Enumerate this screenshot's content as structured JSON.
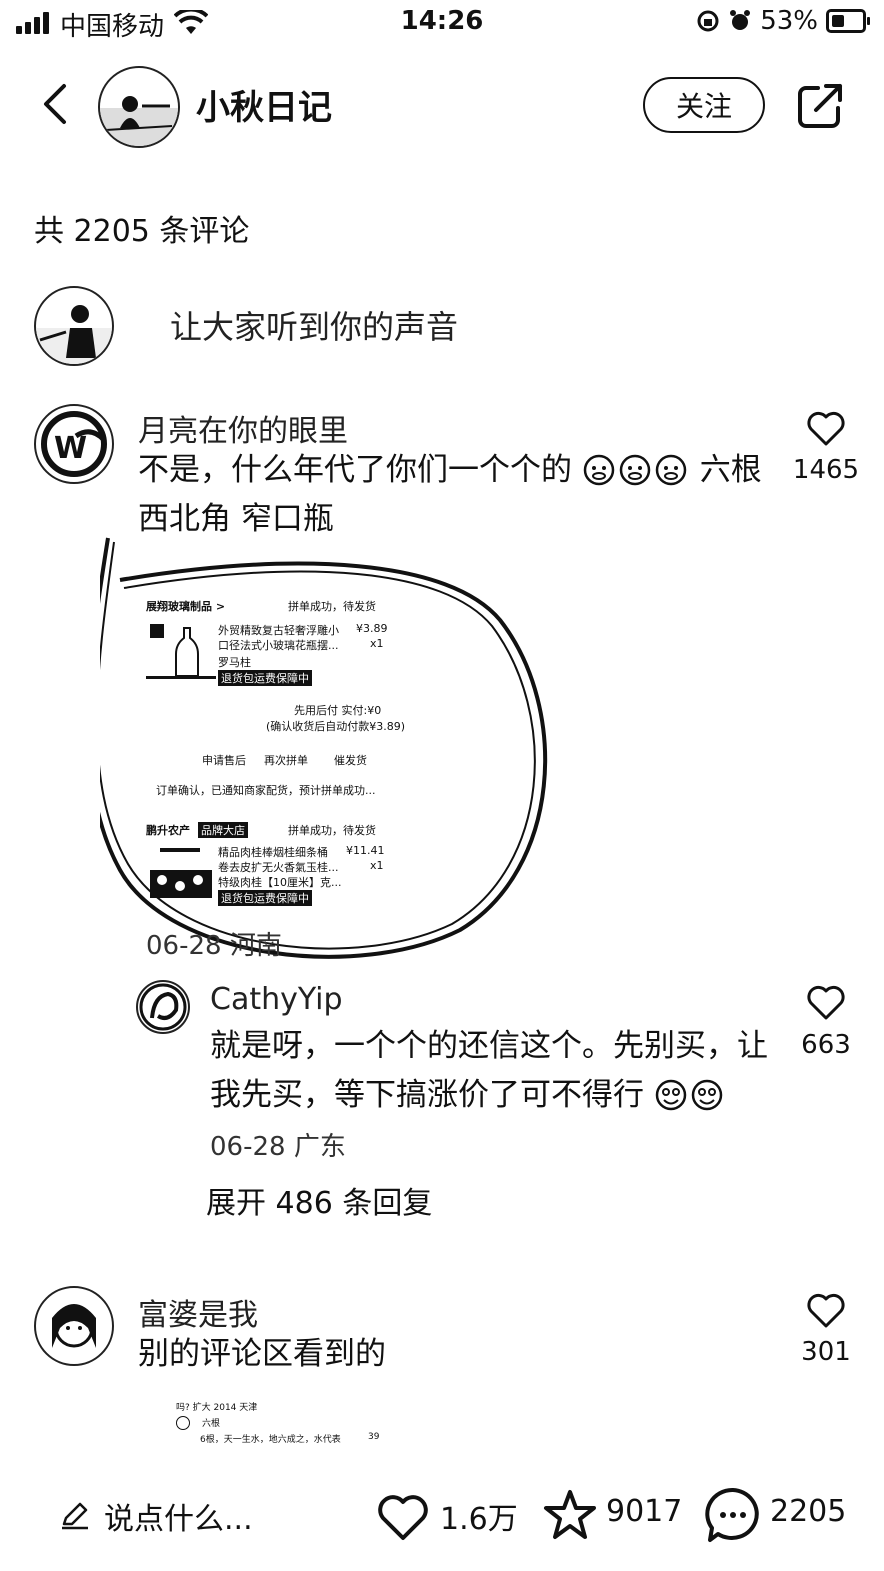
{
  "status_bar": {
    "carrier": "中国移动",
    "time": "14:26",
    "battery": "53%"
  },
  "header": {
    "title": "小秋日记",
    "follow_label": "关注"
  },
  "comments_count": "共 2205 条评论",
  "input_prompt": "让大家听到你的声音",
  "comments": [
    {
      "user": "月亮在你的眼里",
      "text_line1": "不是，什么年代了你们一个个的",
      "text_line1_tail": "六根",
      "text_line2": "西北角 窄口瓶",
      "meta": "06-28 河南",
      "likes": "1465",
      "image": {
        "shop1": "展翔玻璃制品 >",
        "status1": "拼单成功，待发货",
        "product1_line1": "外贸精致复古轻奢浮雕小",
        "product1_line2": "口径法式小玻璃花瓶摆...",
        "price1": "¥3.89",
        "qty1": "x1",
        "spec1": "罗马柱",
        "guarantee1": "退货包运费保障中",
        "pay_line1": "先用后付 实付:¥0",
        "pay_line2": "(确认收货后自动付款¥3.89)",
        "btn_after_sale": "申请售后",
        "btn_rebuy": "再次拼单",
        "btn_urge": "催发货",
        "notice": "订单确认，已通知商家配货，预计拼单成功...",
        "shop2": "鹏升农产",
        "shop2_tag": "品牌大店",
        "status2": "拼单成功，待发货",
        "product2_line1": "精品肉桂棒烟桂细条桶",
        "product2_line2": "卷去皮扩无火香氣玉桂...",
        "price2": "¥11.41",
        "qty2": "x1",
        "spec2": "特级肉桂【10厘米】克...",
        "guarantee2": "退货包运费保障中"
      }
    },
    {
      "user": "CathyYip",
      "text_line1": "就是呀，一个个的还信这个。先别买，让",
      "text_line2": "我先买，等下搞涨价了可不得行",
      "meta": "06-28 广东",
      "likes": "663"
    },
    {
      "user": "富婆是我",
      "text_line1": "别的评论区看到的",
      "likes": "301",
      "image": {
        "row1": "吗? 扩大 2014 天津",
        "row2": "六根",
        "row3": "6根，天一生水，地六成之，水代表",
        "likes": "39"
      }
    }
  ],
  "expand_replies": "展开 486 条回复",
  "bottom_bar": {
    "input_label": "说点什么...",
    "likes": "1.6万",
    "favorites": "9017",
    "comments": "2205"
  }
}
